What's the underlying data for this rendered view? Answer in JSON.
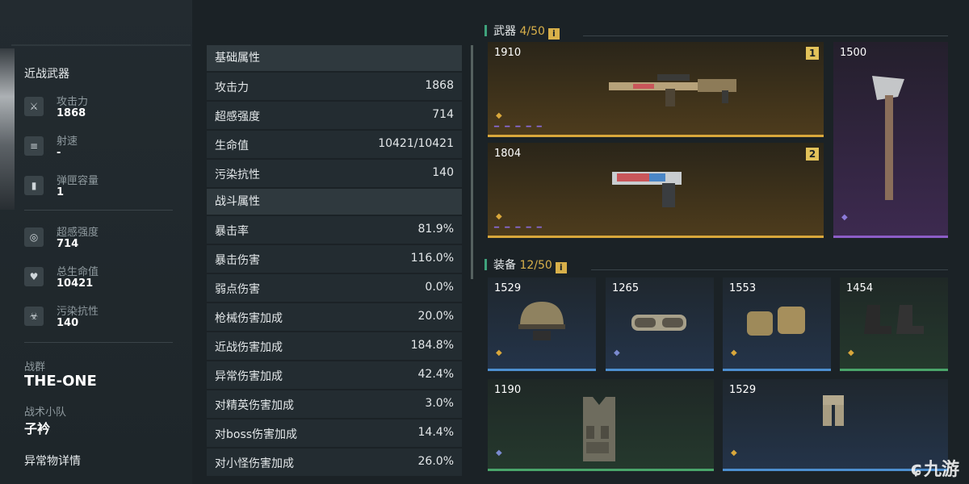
{
  "left": {
    "section_title": "近战武器",
    "stats_a": [
      {
        "icon": "attack-icon",
        "glyph": "⚔",
        "name": "攻击力",
        "value": "1868"
      },
      {
        "icon": "fire-rate-icon",
        "glyph": "≡",
        "name": "射速",
        "value": "-"
      },
      {
        "icon": "magazine-icon",
        "glyph": "▮",
        "name": "弹匣容量",
        "value": "1"
      }
    ],
    "stats_b": [
      {
        "icon": "psi-intensity-icon",
        "glyph": "◎",
        "name": "超感强度",
        "value": "714"
      },
      {
        "icon": "heart-icon",
        "glyph": "♥",
        "name": "总生命值",
        "value": "10421"
      },
      {
        "icon": "biohazard-icon",
        "glyph": "☣",
        "name": "污染抗性",
        "value": "140"
      }
    ],
    "war_group_label": "战群",
    "war_group_value": "THE-ONE",
    "squad_label": "战术小队",
    "squad_value": "子衿",
    "anomaly_label": "异常物详情"
  },
  "attributes": {
    "basic_header": "基础属性",
    "basic": [
      {
        "name": "攻击力",
        "value": "1868"
      },
      {
        "name": "超感强度",
        "value": "714"
      },
      {
        "name": "生命值",
        "value": "10421/10421"
      },
      {
        "name": "污染抗性",
        "value": "140"
      }
    ],
    "combat_header": "战斗属性",
    "combat": [
      {
        "name": "暴击率",
        "value": "81.9%"
      },
      {
        "name": "暴击伤害",
        "value": "116.0%"
      },
      {
        "name": "弱点伤害",
        "value": "0.0%"
      },
      {
        "name": "枪械伤害加成",
        "value": "20.0%"
      },
      {
        "name": "近战伤害加成",
        "value": "184.8%"
      },
      {
        "name": "异常伤害加成",
        "value": "42.4%"
      },
      {
        "name": "对精英伤害加成",
        "value": "3.0%"
      },
      {
        "name": "对boss伤害加成",
        "value": "14.4%"
      },
      {
        "name": "对小怪伤害加成",
        "value": "26.0%"
      }
    ]
  },
  "weapons": {
    "label": "武器",
    "count": "4/50",
    "info_glyph": "i",
    "items": [
      {
        "power": "1910",
        "slot": "1",
        "rarity": "gold",
        "dashes": "━ ━ ━ ━ ━"
      },
      {
        "power": "1804",
        "slot": "2",
        "rarity": "gold",
        "dashes": "━ ━ ━ ━ ━"
      },
      {
        "power": "1500",
        "rarity": "purple"
      }
    ]
  },
  "gear": {
    "label": "装备",
    "count": "12/50",
    "info_glyph": "i",
    "items": [
      {
        "power": "1529",
        "rarity": "gold",
        "name": "helmet"
      },
      {
        "power": "1265",
        "rarity": "blue",
        "name": "goggles"
      },
      {
        "power": "1553",
        "rarity": "gold",
        "name": "gloves"
      },
      {
        "power": "1454",
        "rarity": "gold",
        "name": "boots"
      },
      {
        "power": "1190",
        "rarity": "blue",
        "name": "vest"
      },
      {
        "power": "1529",
        "rarity": "gold",
        "name": "pants"
      }
    ]
  },
  "watermark": {
    "mark": "ɕ",
    "text": "九游"
  },
  "colors": {
    "gold": "#d9a73b",
    "purple": "#8c5dc7",
    "blue": "#4d8fd0",
    "green": "#4aa56a",
    "accent": "#3fa37c"
  }
}
